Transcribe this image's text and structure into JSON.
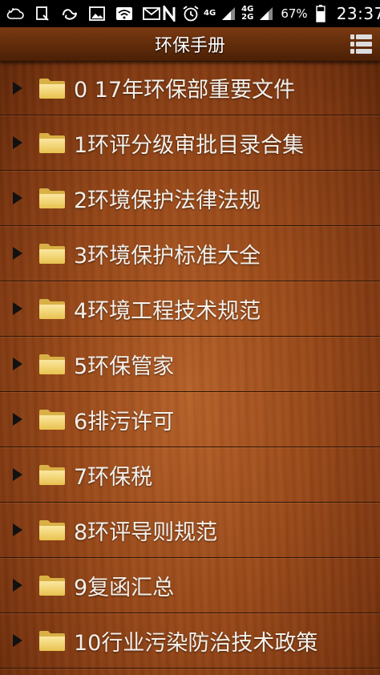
{
  "status_bar": {
    "icons": [
      "weather-cloud-icon",
      "clipboard-icon",
      "uc-browser-icon",
      "image-icon",
      "wifi-icon",
      "mail-icon",
      "nfc-icon",
      "alarm-icon"
    ],
    "network1": "4G",
    "network2_top": "4G",
    "network2_bottom": "2G",
    "battery_percent": "67%",
    "time": "23:37"
  },
  "app_bar": {
    "title": "环保手册",
    "menu_icon": "list-menu-icon"
  },
  "list": {
    "items": [
      {
        "label": "0  17年环保部重要文件"
      },
      {
        "label": "1环评分级审批目录合集"
      },
      {
        "label": "2环境保护法律法规"
      },
      {
        "label": "3环境保护标准大全"
      },
      {
        "label": "4环境工程技术规范"
      },
      {
        "label": "5环保管家"
      },
      {
        "label": "6排污许可"
      },
      {
        "label": "7环保税"
      },
      {
        "label": "8环评导则规范"
      },
      {
        "label": "9复函汇总"
      },
      {
        "label": "10行业污染防治技术政策"
      }
    ]
  },
  "colors": {
    "wood": "#9a4a1a",
    "divider": "#2f1406",
    "folder": "#f2d46a",
    "text": "#f4f0ea"
  }
}
